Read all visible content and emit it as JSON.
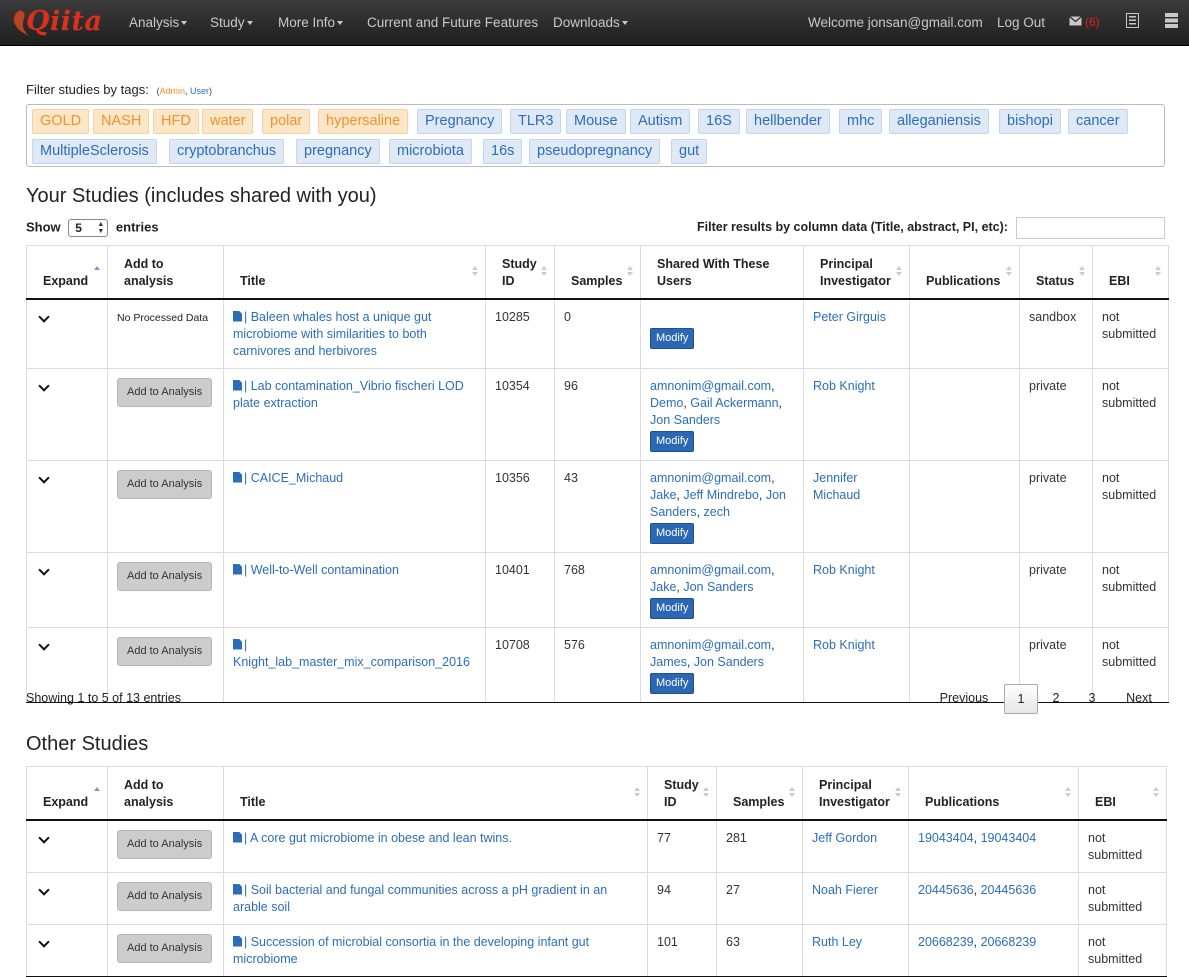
{
  "nav": {
    "brand": "Qiita",
    "menu": [
      "Analysis",
      "Study",
      "More Info",
      "Current and Future Features",
      "Downloads"
    ],
    "welcome": "Welcome jonsan@gmail.com",
    "logout": "Log Out",
    "message_count": "(6)"
  },
  "filter": {
    "label": "Filter studies by tags:",
    "hint_open": "(",
    "hint_admin": "Admin",
    "hint_sep": ",",
    "hint_user": "User",
    "hint_close": ")",
    "admin_tags": [
      "GOLD",
      "NASH",
      "HFD",
      "water",
      "polar",
      "hypersaline"
    ],
    "user_tags": [
      "Pregnancy",
      "TLR3",
      "Mouse",
      "Autism",
      "16S",
      "hellbender",
      "mhc",
      "alleganiensis",
      "bishopi",
      "cancer",
      "MultipleSclerosis",
      "cryptobranchus",
      "pregnancy",
      "microbiota",
      "16s",
      "pseudopregnancy",
      "gut"
    ]
  },
  "your_studies": {
    "title": "Your Studies (includes shared with you)",
    "show_label": "Show",
    "show_value": "5",
    "entries_label": "entries",
    "filter_label": "Filter results by column data (Title, abstract, PI, etc):",
    "columns": [
      "Expand",
      "Add to analysis",
      "Title",
      "Study ID",
      "Samples",
      "Shared With These Users",
      "Principal Investigator",
      "Publications",
      "Status",
      "EBI"
    ],
    "add_label": "Add to Analysis",
    "no_processed": "No Processed Data",
    "modify_label": "Modify",
    "rows": [
      {
        "title": "| Baleen whales host a unique gut microbiome with similarities to both carnivores and herbivores",
        "study_id": "10285",
        "samples": "0",
        "shared": [],
        "pi": "Peter Girguis",
        "status": "sandbox",
        "ebi": "not submitted",
        "processed": false
      },
      {
        "title": "| Lab contamination_Vibrio fischeri LOD plate extraction",
        "study_id": "10354",
        "samples": "96",
        "shared": [
          "amnonim@gmail.com",
          "Demo",
          "Gail Ackermann",
          "Jon Sanders"
        ],
        "pi": "Rob Knight",
        "status": "private",
        "ebi": "not submitted",
        "processed": true
      },
      {
        "title": "| CAICE_Michaud",
        "study_id": "10356",
        "samples": "43",
        "shared": [
          "amnonim@gmail.com",
          "Jake",
          "Jeff Mindrebo",
          "Jon Sanders",
          "zech"
        ],
        "pi": "Jennifer Michaud",
        "status": "private",
        "ebi": "not submitted",
        "processed": true
      },
      {
        "title": "| Well-to-Well contamination",
        "study_id": "10401",
        "samples": "768",
        "shared": [
          "amnonim@gmail.com",
          "Jake",
          "Jon Sanders"
        ],
        "pi": "Rob Knight",
        "status": "private",
        "ebi": "not submitted",
        "processed": true
      },
      {
        "title": "| Knight_lab_master_mix_comparison_2016",
        "study_id": "10708",
        "samples": "576",
        "shared": [
          "amnonim@gmail.com",
          "James",
          "Jon Sanders"
        ],
        "pi": "Rob Knight",
        "status": "private",
        "ebi": "not submitted",
        "processed": true
      }
    ],
    "showing": "Showing 1 to 5 of 13 entries",
    "pagination": {
      "previous": "Previous",
      "pages": [
        "1",
        "2",
        "3"
      ],
      "next": "Next"
    }
  },
  "other_studies": {
    "title": "Other Studies",
    "columns": [
      "Expand",
      "Add to analysis",
      "Title",
      "Study ID",
      "Samples",
      "Principal Investigator",
      "Publications",
      "EBI"
    ],
    "rows": [
      {
        "title": "| A core gut microbiome in obese and lean twins.",
        "study_id": "77",
        "samples": "281",
        "pi": "Jeff Gordon",
        "publications": [
          "19043404",
          "19043404"
        ],
        "ebi": "not submitted"
      },
      {
        "title": "| Soil bacterial and fungal communities across a pH gradient in an arable soil",
        "study_id": "94",
        "samples": "27",
        "pi": "Noah Fierer",
        "publications": [
          "20445636",
          "20445636"
        ],
        "ebi": "not submitted"
      },
      {
        "title": "| Succession of microbial consortia in the developing infant gut microbiome",
        "study_id": "101",
        "samples": "63",
        "pi": "Ruth Ley",
        "publications": [
          "20668239",
          "20668239"
        ],
        "ebi": "not submitted"
      }
    ]
  }
}
